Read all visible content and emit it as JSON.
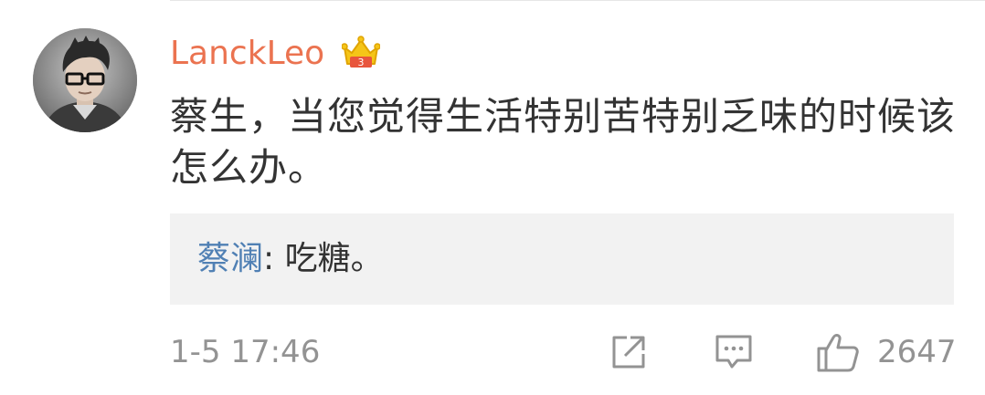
{
  "comment": {
    "username": "LanckLeo",
    "username_color": "#eb7350",
    "badge_icon": "crown-icon",
    "text": "蔡生，当您觉得生活特别苦特别乏味的时候该怎么办。",
    "reply": {
      "author": "蔡澜",
      "separator": ": ",
      "text": "吃糖。",
      "author_color": "#5080b4"
    },
    "timestamp": "1-5 17:46",
    "actions": {
      "share_icon": "share-icon",
      "comment_icon": "comment-icon",
      "like_icon": "thumbs-up-icon",
      "like_count": "2647"
    }
  }
}
